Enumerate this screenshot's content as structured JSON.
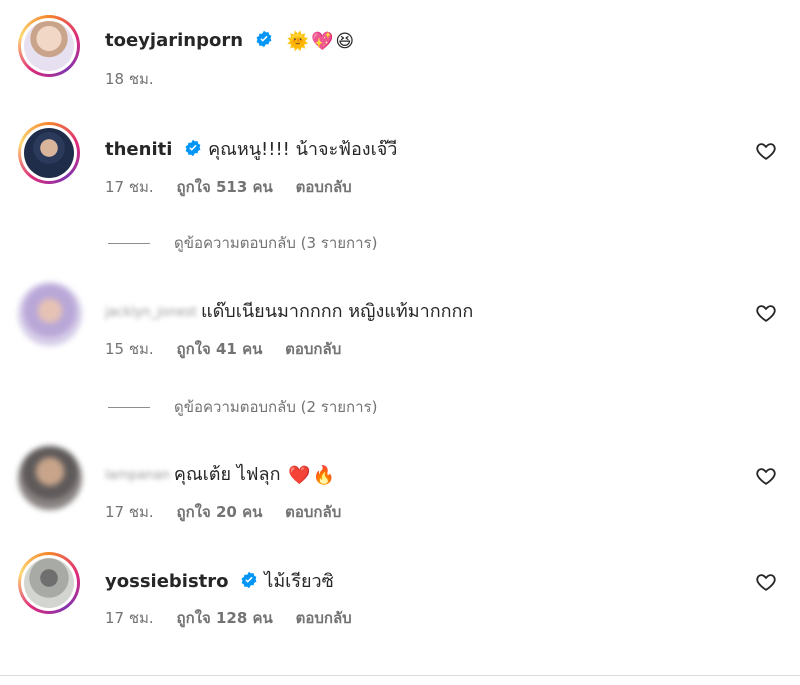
{
  "comments": [
    {
      "username": "toeyjarinporn",
      "verified": true,
      "text": "",
      "emojis": [
        "🌞",
        "💖",
        "😆"
      ],
      "time": "18 ชม.",
      "likes": "",
      "reply": ""
    },
    {
      "username": "theniti",
      "verified": true,
      "text": "คุณหนู!!!! น้าจะฟ้องเจ๊วี",
      "time": "17 ชม.",
      "likes": "ถูกใจ 513 คน",
      "reply": "ตอบกลับ"
    },
    {
      "username": "jacklyn_jonest",
      "verified": false,
      "text": "แด๊บเนียนมากกกก หญิงแท้มากกกก",
      "time": "15 ชม.",
      "likes": "ถูกใจ 41 คน",
      "reply": "ตอบกลับ"
    },
    {
      "username": "lampanan",
      "verified": false,
      "text": "คุณเต้ย ไฟลุก",
      "emojis": [
        "❤️",
        "🔥"
      ],
      "time": "17 ชม.",
      "likes": "ถูกใจ 20 คน",
      "reply": "ตอบกลับ"
    },
    {
      "username": "yossiebistro",
      "verified": true,
      "text": "ไม้เรียวซิ",
      "time": "17 ชม.",
      "likes": "ถูกใจ 128 คน",
      "reply": "ตอบกลับ"
    }
  ],
  "view_replies": [
    {
      "label": "ดูข้อความตอบกลับ (3 รายการ)"
    },
    {
      "label": "ดูข้อความตอบกลับ (2 รายการ)"
    }
  ],
  "icons": {
    "verified": "verified-badge-icon",
    "like": "heart-outline-icon"
  },
  "colors": {
    "verified": "#0095f6",
    "muted": "#737373",
    "text": "#262626"
  }
}
